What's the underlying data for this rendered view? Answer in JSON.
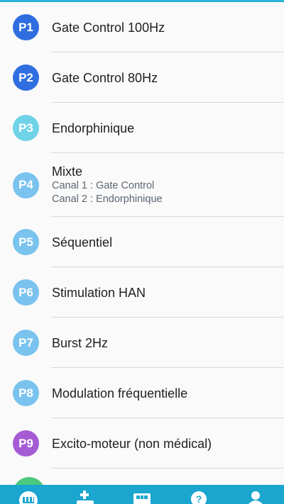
{
  "programs": [
    {
      "badge": "P1",
      "title": "Gate Control 100Hz",
      "color": "#2f6ee0"
    },
    {
      "badge": "P2",
      "title": "Gate Control 80Hz",
      "color": "#2f6ee0"
    },
    {
      "badge": "P3",
      "title": "Endorphinique",
      "color": "#6fd3e8"
    },
    {
      "badge": "P4",
      "title": "Mixte",
      "sub1": "Canal 1 : Gate Control",
      "sub2": "Canal 2 : Endorphinique",
      "color": "#79c3ee"
    },
    {
      "badge": "P5",
      "title": "Séquentiel",
      "color": "#79c3ee"
    },
    {
      "badge": "P6",
      "title": "Stimulation HAN",
      "color": "#79c3ee"
    },
    {
      "badge": "P7",
      "title": "Burst 2Hz",
      "color": "#79c3ee"
    },
    {
      "badge": "P8",
      "title": "Modulation fréquentielle",
      "color": "#79c3ee"
    },
    {
      "badge": "P9",
      "title": "Excito-moteur (non médical)",
      "color": "#a55bd4"
    }
  ],
  "nav": [
    {
      "icon": "programs-icon"
    },
    {
      "icon": "add-program-icon"
    },
    {
      "icon": "electrodes-icon"
    },
    {
      "icon": "help-icon"
    },
    {
      "icon": "profile-icon"
    }
  ],
  "colors": {
    "accent": "#1aa6cf",
    "next_badge": "#4cc97e"
  }
}
